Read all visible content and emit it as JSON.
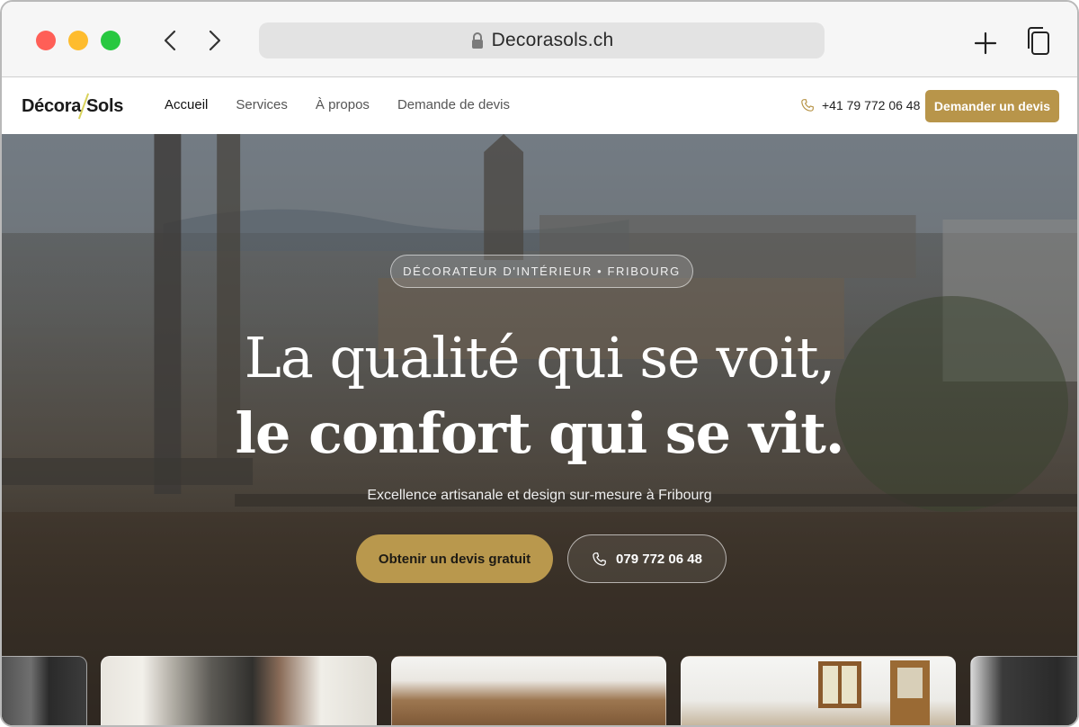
{
  "browser": {
    "url": "Decorasols.ch"
  },
  "header": {
    "logo_left": "Décora",
    "logo_right": "Sols",
    "nav": [
      {
        "label": "Accueil"
      },
      {
        "label": "Services"
      },
      {
        "label": "À propos"
      },
      {
        "label": "Demande de devis"
      }
    ],
    "phone": "+41 79 772 06 48",
    "cta": "Demander un devis"
  },
  "hero": {
    "badge": "DÉCORATEUR D'INTÉRIEUR • FRIBOURG",
    "headline_1": "La qualité qui se voit,",
    "headline_2": "le confort qui se vit.",
    "subtitle": "Excellence artisanale et design sur-mesure à Fribourg",
    "btn_quote": "Obtenir un devis gratuit",
    "btn_call": "079 772 06 48"
  },
  "colors": {
    "accent": "#b8954a",
    "logo_slash": "#d8d25a"
  },
  "icons": [
    "lock-icon",
    "back-icon",
    "forward-icon",
    "new-tab-icon",
    "tabs-icon",
    "phone-icon"
  ]
}
